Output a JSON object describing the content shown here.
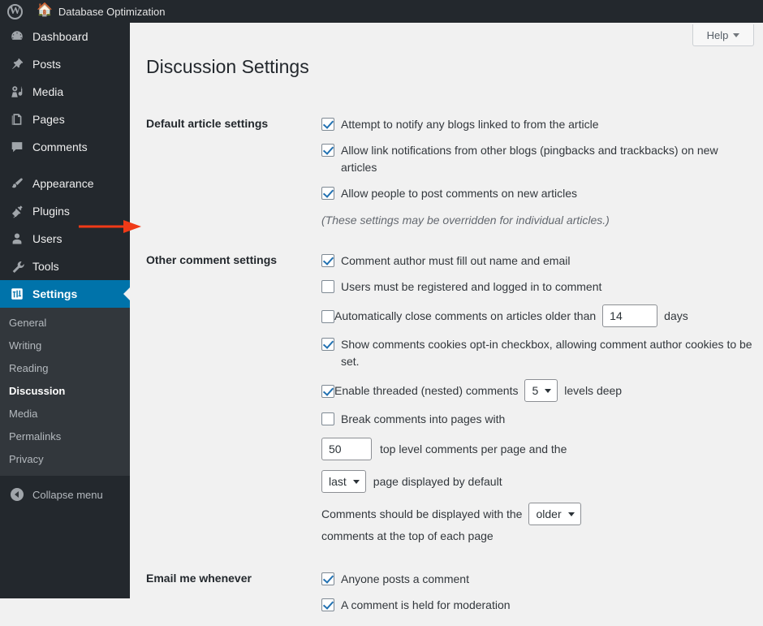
{
  "adminbar": {
    "wp_logo": "wordpress-logo",
    "home_icon": "home-icon",
    "site_name": "Database Optimization"
  },
  "sidebar": {
    "items": [
      {
        "label": "Dashboard",
        "icon": "dashboard-icon",
        "current": false
      },
      {
        "label": "Posts",
        "icon": "pin-icon",
        "current": false
      },
      {
        "label": "Media",
        "icon": "media-icon",
        "current": false
      },
      {
        "label": "Pages",
        "icon": "pages-icon",
        "current": false
      },
      {
        "label": "Comments",
        "icon": "comment-bubble-icon",
        "current": false
      },
      {
        "label": "Appearance",
        "icon": "paintbrush-icon",
        "current": false
      },
      {
        "label": "Plugins",
        "icon": "plug-icon",
        "current": false
      },
      {
        "label": "Users",
        "icon": "user-icon",
        "current": false
      },
      {
        "label": "Tools",
        "icon": "wrench-icon",
        "current": false
      },
      {
        "label": "Settings",
        "icon": "settings-sliders-icon",
        "current": true
      }
    ],
    "submenu": [
      {
        "label": "General",
        "current": false
      },
      {
        "label": "Writing",
        "current": false
      },
      {
        "label": "Reading",
        "current": false
      },
      {
        "label": "Discussion",
        "current": true
      },
      {
        "label": "Media",
        "current": false
      },
      {
        "label": "Permalinks",
        "current": false
      },
      {
        "label": "Privacy",
        "current": false
      }
    ],
    "collapse_label": "Collapse menu",
    "collapse_icon": "collapse-left-arrow-icon",
    "bg_color": "#23282d",
    "submenu_bg_color": "#32373c",
    "current_color": "#0073aa"
  },
  "header": {
    "help_label": "Help",
    "help_caret": "chevron-down-icon"
  },
  "page": {
    "title": "Discussion Settings"
  },
  "sections": {
    "default_article": {
      "heading": "Default article settings",
      "options": [
        {
          "label": "Attempt to notify any blogs linked to from the article",
          "checked": true
        },
        {
          "label": "Allow link notifications from other blogs (pingbacks and trackbacks) on new articles",
          "checked": true
        },
        {
          "label": "Allow people to post comments on new articles",
          "checked": true
        }
      ],
      "hint": "(These settings may be overridden for individual articles.)"
    },
    "other_comment": {
      "heading": "Other comment settings",
      "opt_author_name_email": {
        "label": "Comment author must fill out name and email",
        "checked": true
      },
      "opt_registered": {
        "label": "Users must be registered and logged in to comment",
        "checked": false
      },
      "opt_autoclose": {
        "label_before": "Automatically close comments on articles older than",
        "days_value": "14",
        "label_after": "days",
        "checked": false
      },
      "opt_cookies": {
        "label": "Show comments cookies opt-in checkbox, allowing comment author cookies to be set.",
        "checked": true
      },
      "opt_threaded": {
        "label_before": "Enable threaded (nested) comments",
        "levels_value": "5",
        "label_after": "levels deep",
        "checked": true
      },
      "opt_paginate": {
        "label": "Break comments into pages with",
        "checked": false
      },
      "per_page_value": "50",
      "per_page_after": "top level comments per page and the",
      "default_page_value": "last",
      "default_page_after": "page displayed by default",
      "order_before": "Comments should be displayed with the",
      "order_value": "older",
      "order_after": "comments at the top of each page"
    },
    "email_me": {
      "heading": "Email me whenever",
      "options": [
        {
          "label": "Anyone posts a comment",
          "checked": true
        },
        {
          "label": "A comment is held for moderation",
          "checked": true
        }
      ]
    }
  },
  "annotation": {
    "type": "arrow",
    "color": "#f03a17",
    "points_to": "Other comment settings"
  }
}
